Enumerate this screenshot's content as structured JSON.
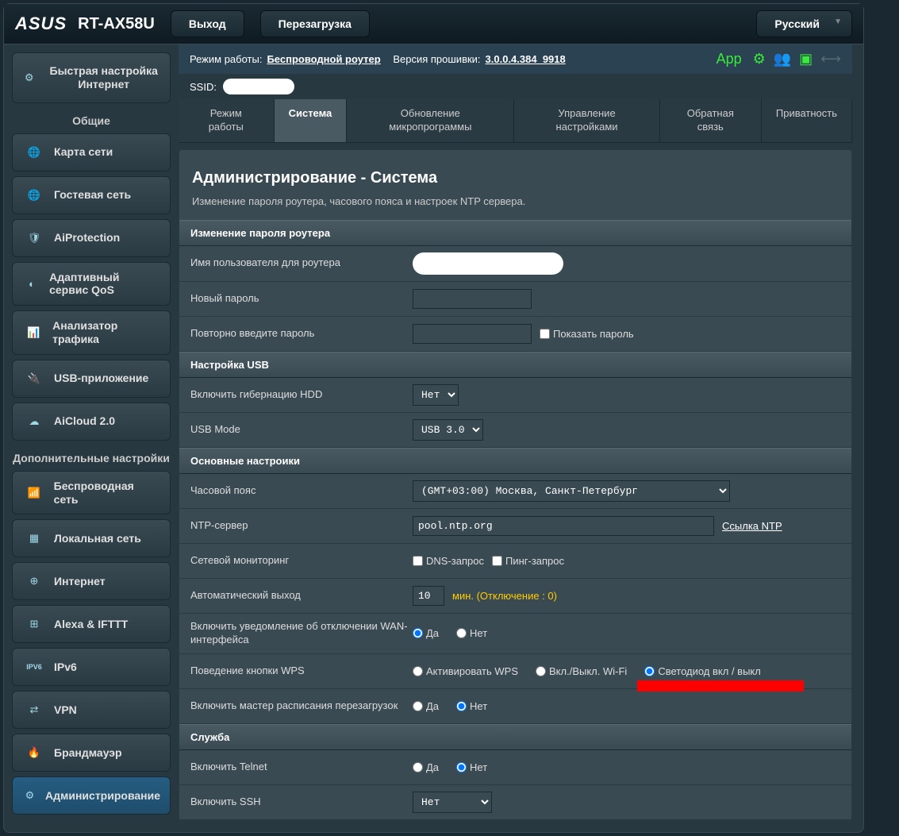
{
  "brand": "ASUS",
  "model": "RT-AX58U",
  "top": {
    "logout": "Выход",
    "reboot": "Перезагрузка",
    "language": "Русский"
  },
  "status": {
    "mode_label": "Режим работы:",
    "mode_value": "Беспроводной роутер",
    "fw_label": "Версия прошивки:",
    "fw_value": "3.0.0.4.384_9918",
    "ssid_label": "SSID:",
    "app": "App"
  },
  "quick": "Быстрая настройка Интернет",
  "side_hdr_general": "Общие",
  "side_hdr_advanced": "Дополнительные настройки",
  "sidebar_general": [
    "Карта сети",
    "Гостевая сеть",
    "AiProtection",
    "Адаптивный сервис QoS",
    "Анализатор трафика",
    "USB-приложение",
    "AiCloud 2.0"
  ],
  "sidebar_advanced": [
    "Беспроводная сеть",
    "Локальная сеть",
    "Интернет",
    "Alexa & IFTTT",
    "IPv6",
    "VPN",
    "Брандмауэр",
    "Администрирование"
  ],
  "tabs": [
    "Режим работы",
    "Система",
    "Обновление микропрограммы",
    "Управление настройками",
    "Обратная связь",
    "Приватность"
  ],
  "page": {
    "title": "Администрирование - Система",
    "desc": "Изменение пароля роутера, часового пояса и настроек NTP сервера."
  },
  "sec": {
    "pwd": "Изменение пароля роутера",
    "usb": "Настройка USB",
    "basic": "Основные настроики",
    "service": "Служба"
  },
  "labels": {
    "username": "Имя пользователя для роутера",
    "new_pwd": "Новый пароль",
    "retype_pwd": "Повторно введите пароль",
    "show_pwd": "Показать пароль",
    "hdd_hib": "Включить гибернацию HDD",
    "usb_mode": "USB Mode",
    "timezone": "Часовой пояс",
    "ntp": "NTP-сервер",
    "ntp_link": "Ссылка NTP",
    "net_mon": "Сетевой мониторинг",
    "dns_q": "DNS-запрос",
    "ping_q": "Пинг-запрос",
    "auto_logout": "Автоматический выход",
    "auto_logout_value": "10",
    "auto_logout_hint": "мин. (Отключение : 0)",
    "wan_notify": "Включить уведомление об отключении WAN-интерфейса",
    "wps_btn": "Поведение кнопки WPS",
    "wps_opt1": "Активировать WPS",
    "wps_opt2": "Вкл./Выкл. Wi-Fi",
    "wps_opt3": "Светодиод вкл / выкл",
    "reboot_sched": "Включить мастер расписания перезагрузок",
    "telnet": "Включить Telnet",
    "ssh": "Включить SSH",
    "yes": "Да",
    "no": "Нет"
  },
  "values": {
    "hdd_hib": "Нет",
    "usb_mode": "USB 3.0",
    "timezone": "(GMT+03:00) Москва, Санкт-Петербург",
    "ntp": "pool.ntp.org",
    "ssh": "Нет"
  }
}
